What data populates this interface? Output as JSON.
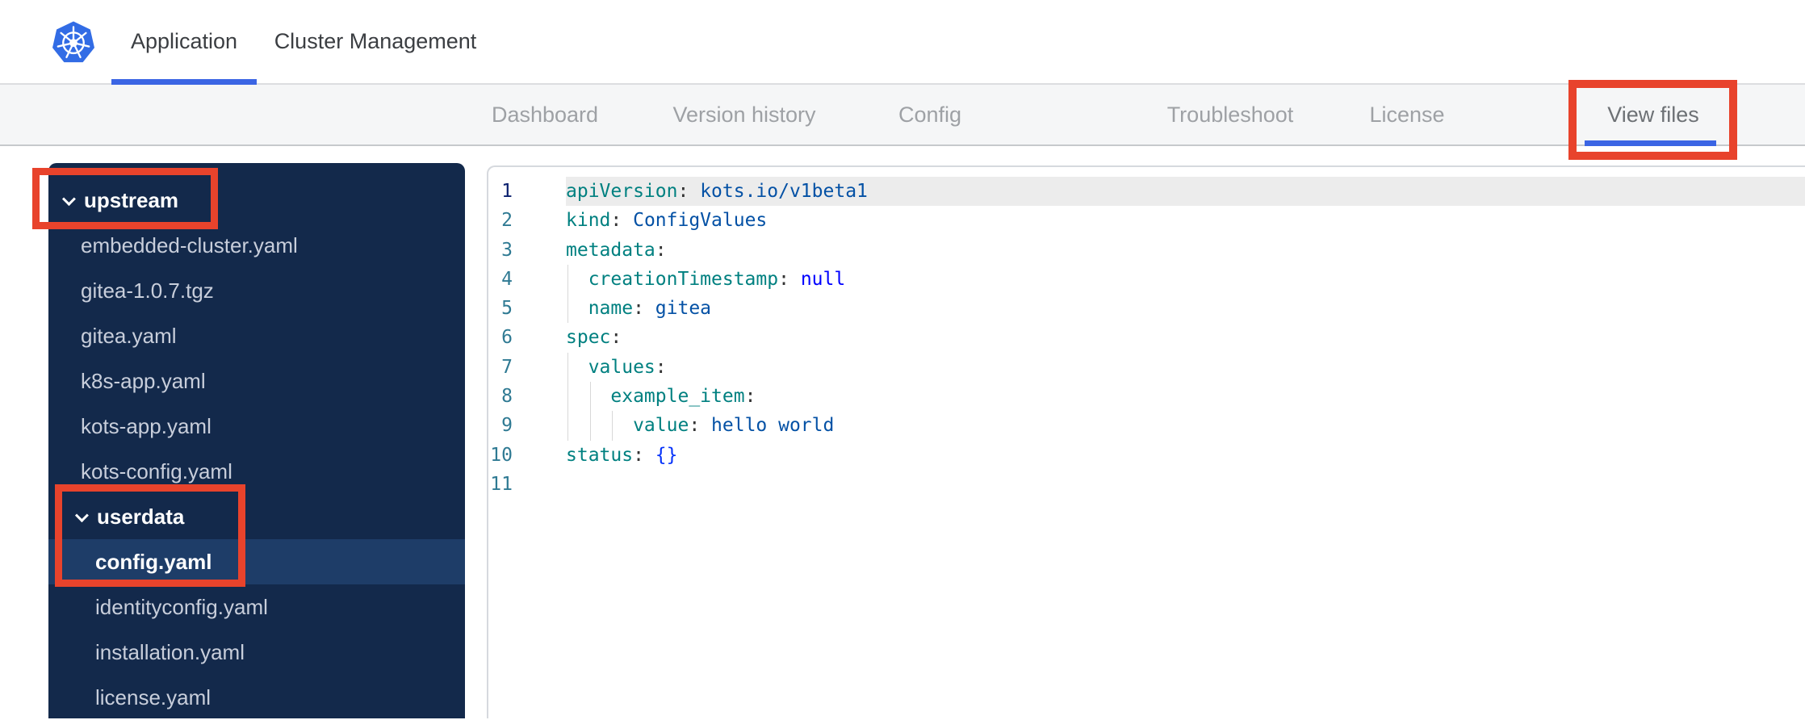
{
  "header": {
    "tabs": [
      "Application",
      "Cluster Management"
    ],
    "logo_icon": "kubernetes-helm-wheel",
    "active_tab": "Application"
  },
  "nav": {
    "tabs": [
      "Dashboard",
      "Version history",
      "Config",
      "Troubleshoot",
      "License",
      "View files"
    ],
    "active_tab": "View files"
  },
  "sidebar": {
    "upstream": {
      "label": "upstream",
      "expanded": true,
      "files": [
        "embedded-cluster.yaml",
        "gitea-1.0.7.tgz",
        "gitea.yaml",
        "k8s-app.yaml",
        "kots-app.yaml",
        "kots-config.yaml"
      ]
    },
    "userdata": {
      "label": "userdata",
      "expanded": true,
      "files": [
        "config.yaml",
        "identityconfig.yaml",
        "installation.yaml",
        "license.yaml"
      ],
      "selected": "config.yaml"
    }
  },
  "editor": {
    "active_line": 1,
    "lines": [
      {
        "num": "1",
        "key": "apiVersion",
        "sep": ": ",
        "val": "kots.io/v1beta1"
      },
      {
        "num": "2",
        "key": "kind",
        "sep": ": ",
        "val": "ConfigValues"
      },
      {
        "num": "3",
        "key": "metadata",
        "sep": ":"
      },
      {
        "num": "4",
        "key": "  creationTimestamp",
        "sep": ": ",
        "val": "null"
      },
      {
        "num": "5",
        "key": "  name",
        "sep": ": ",
        "val": "gitea"
      },
      {
        "num": "6",
        "key": "spec",
        "sep": ":"
      },
      {
        "num": "7",
        "key": "  values",
        "sep": ":"
      },
      {
        "num": "8",
        "key": "    example_item",
        "sep": ":"
      },
      {
        "num": "9",
        "key": "      value",
        "sep": ": ",
        "val": "hello world"
      },
      {
        "num": "10",
        "key": "status",
        "sep": ": ",
        "val": "{}"
      },
      {
        "num": "11",
        "key": "",
        "sep": ""
      }
    ]
  },
  "colors": {
    "accent_blue": "#3b65e4",
    "logo_blue": "#326ce5",
    "annotation_red": "#e8432c",
    "sidebar_navy": "#13294b",
    "sidebar_selected": "#1e3d68",
    "yaml_key": "#008080",
    "yaml_string": "#0451a5",
    "yaml_keyword": "#0000ff",
    "line_number": "#2f7a93",
    "active_line_number": "#0b216f"
  }
}
